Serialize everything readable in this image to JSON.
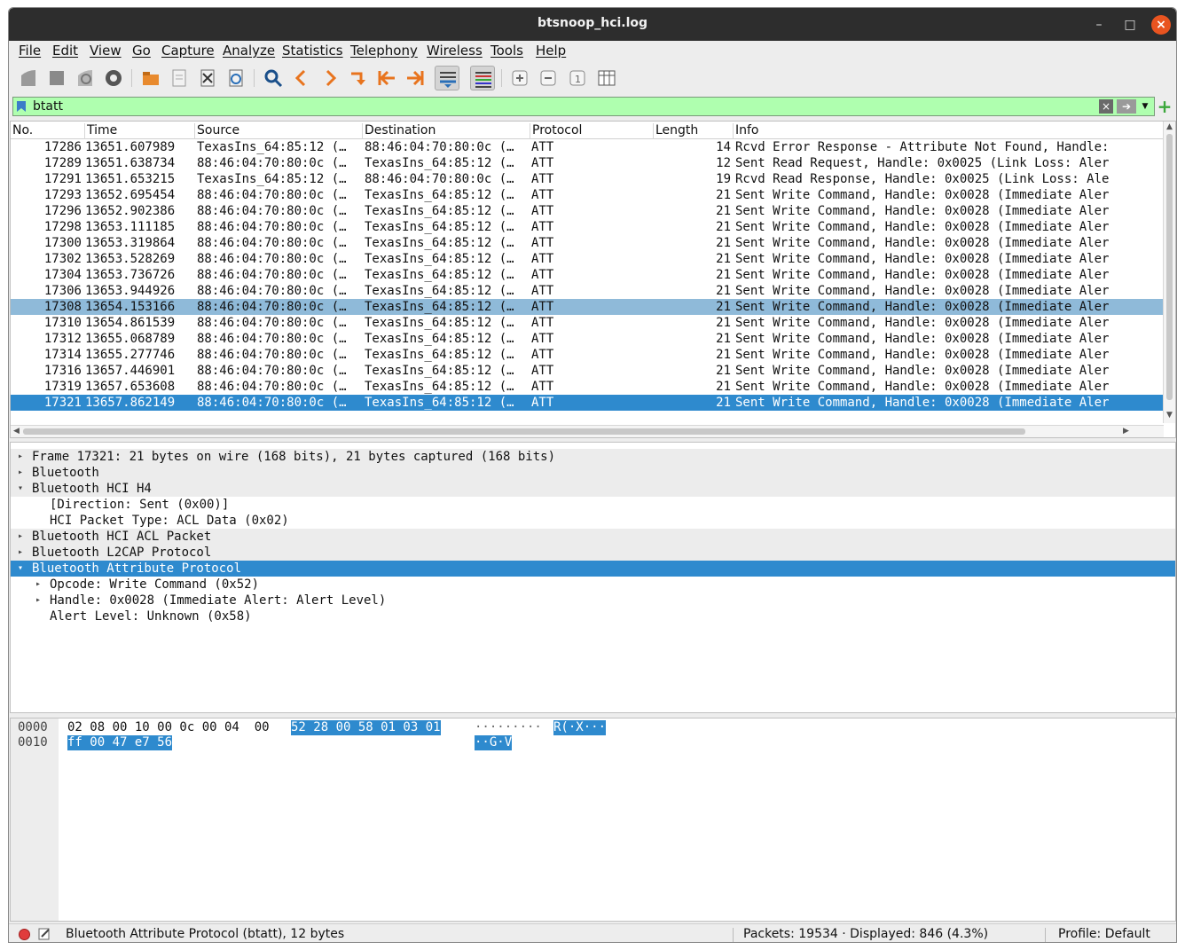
{
  "window": {
    "title": "btsnoop_hci.log"
  },
  "menu": [
    "File",
    "Edit",
    "View",
    "Go",
    "Capture",
    "Analyze",
    "Statistics",
    "Telephony",
    "Wireless",
    "Tools",
    "Help"
  ],
  "filter": {
    "value": "btatt"
  },
  "columns": [
    "No.",
    "Time",
    "Source",
    "Destination",
    "Protocol",
    "Length",
    "Info"
  ],
  "packets": [
    {
      "no": "17286",
      "time": "13651.607989",
      "src": "TexasIns_64:85:12 (…",
      "dst": "88:46:04:70:80:0c (…",
      "proto": "ATT",
      "len": "14",
      "info": "Rcvd Error Response - Attribute Not Found, Handle:",
      "state": ""
    },
    {
      "no": "17289",
      "time": "13651.638734",
      "src": "88:46:04:70:80:0c (…",
      "dst": "TexasIns_64:85:12 (…",
      "proto": "ATT",
      "len": "12",
      "info": "Sent Read Request, Handle: 0x0025 (Link Loss: Aler",
      "state": ""
    },
    {
      "no": "17291",
      "time": "13651.653215",
      "src": "TexasIns_64:85:12 (…",
      "dst": "88:46:04:70:80:0c (…",
      "proto": "ATT",
      "len": "19",
      "info": "Rcvd Read Response, Handle: 0x0025 (Link Loss: Ale",
      "state": ""
    },
    {
      "no": "17293",
      "time": "13652.695454",
      "src": "88:46:04:70:80:0c (…",
      "dst": "TexasIns_64:85:12 (…",
      "proto": "ATT",
      "len": "21",
      "info": "Sent Write Command, Handle: 0x0028 (Immediate Aler",
      "state": ""
    },
    {
      "no": "17296",
      "time": "13652.902386",
      "src": "88:46:04:70:80:0c (…",
      "dst": "TexasIns_64:85:12 (…",
      "proto": "ATT",
      "len": "21",
      "info": "Sent Write Command, Handle: 0x0028 (Immediate Aler",
      "state": ""
    },
    {
      "no": "17298",
      "time": "13653.111185",
      "src": "88:46:04:70:80:0c (…",
      "dst": "TexasIns_64:85:12 (…",
      "proto": "ATT",
      "len": "21",
      "info": "Sent Write Command, Handle: 0x0028 (Immediate Aler",
      "state": ""
    },
    {
      "no": "17300",
      "time": "13653.319864",
      "src": "88:46:04:70:80:0c (…",
      "dst": "TexasIns_64:85:12 (…",
      "proto": "ATT",
      "len": "21",
      "info": "Sent Write Command, Handle: 0x0028 (Immediate Aler",
      "state": ""
    },
    {
      "no": "17302",
      "time": "13653.528269",
      "src": "88:46:04:70:80:0c (…",
      "dst": "TexasIns_64:85:12 (…",
      "proto": "ATT",
      "len": "21",
      "info": "Sent Write Command, Handle: 0x0028 (Immediate Aler",
      "state": ""
    },
    {
      "no": "17304",
      "time": "13653.736726",
      "src": "88:46:04:70:80:0c (…",
      "dst": "TexasIns_64:85:12 (…",
      "proto": "ATT",
      "len": "21",
      "info": "Sent Write Command, Handle: 0x0028 (Immediate Aler",
      "state": ""
    },
    {
      "no": "17306",
      "time": "13653.944926",
      "src": "88:46:04:70:80:0c (…",
      "dst": "TexasIns_64:85:12 (…",
      "proto": "ATT",
      "len": "21",
      "info": "Sent Write Command, Handle: 0x0028 (Immediate Aler",
      "state": ""
    },
    {
      "no": "17308",
      "time": "13654.153166",
      "src": "88:46:04:70:80:0c (…",
      "dst": "TexasIns_64:85:12 (…",
      "proto": "ATT",
      "len": "21",
      "info": "Sent Write Command, Handle: 0x0028 (Immediate Aler",
      "state": "related"
    },
    {
      "no": "17310",
      "time": "13654.861539",
      "src": "88:46:04:70:80:0c (…",
      "dst": "TexasIns_64:85:12 (…",
      "proto": "ATT",
      "len": "21",
      "info": "Sent Write Command, Handle: 0x0028 (Immediate Aler",
      "state": ""
    },
    {
      "no": "17312",
      "time": "13655.068789",
      "src": "88:46:04:70:80:0c (…",
      "dst": "TexasIns_64:85:12 (…",
      "proto": "ATT",
      "len": "21",
      "info": "Sent Write Command, Handle: 0x0028 (Immediate Aler",
      "state": ""
    },
    {
      "no": "17314",
      "time": "13655.277746",
      "src": "88:46:04:70:80:0c (…",
      "dst": "TexasIns_64:85:12 (…",
      "proto": "ATT",
      "len": "21",
      "info": "Sent Write Command, Handle: 0x0028 (Immediate Aler",
      "state": ""
    },
    {
      "no": "17316",
      "time": "13657.446901",
      "src": "88:46:04:70:80:0c (…",
      "dst": "TexasIns_64:85:12 (…",
      "proto": "ATT",
      "len": "21",
      "info": "Sent Write Command, Handle: 0x0028 (Immediate Aler",
      "state": ""
    },
    {
      "no": "17319",
      "time": "13657.653608",
      "src": "88:46:04:70:80:0c (…",
      "dst": "TexasIns_64:85:12 (…",
      "proto": "ATT",
      "len": "21",
      "info": "Sent Write Command, Handle: 0x0028 (Immediate Aler",
      "state": ""
    },
    {
      "no": "17321",
      "time": "13657.862149",
      "src": "88:46:04:70:80:0c (…",
      "dst": "TexasIns_64:85:12 (…",
      "proto": "ATT",
      "len": "21",
      "info": "Sent Write Command, Handle: 0x0028 (Immediate Aler",
      "state": "selected"
    }
  ],
  "details": [
    {
      "text": "Frame 17321: 21 bytes on wire (168 bits), 21 bytes captured (168 bits)",
      "depth": 0,
      "tri": "right",
      "style": "hl"
    },
    {
      "text": "Bluetooth",
      "depth": 0,
      "tri": "right",
      "style": "hl"
    },
    {
      "text": "Bluetooth HCI H4",
      "depth": 0,
      "tri": "down",
      "style": "hl"
    },
    {
      "text": "[Direction: Sent (0x00)]",
      "depth": 1,
      "tri": "",
      "style": ""
    },
    {
      "text": "HCI Packet Type: ACL Data (0x02)",
      "depth": 1,
      "tri": "",
      "style": ""
    },
    {
      "text": "Bluetooth HCI ACL Packet",
      "depth": 0,
      "tri": "right",
      "style": "hl"
    },
    {
      "text": "Bluetooth L2CAP Protocol",
      "depth": 0,
      "tri": "right",
      "style": "hl"
    },
    {
      "text": "Bluetooth Attribute Protocol",
      "depth": 0,
      "tri": "down",
      "style": "sel"
    },
    {
      "text": "Opcode: Write Command (0x52)",
      "depth": 1,
      "tri": "right",
      "style": ""
    },
    {
      "text": "Handle: 0x0028 (Immediate Alert: Alert Level)",
      "depth": 1,
      "tri": "right",
      "style": ""
    },
    {
      "text": "Alert Level: Unknown (0x58)",
      "depth": 1,
      "tri": "",
      "style": ""
    }
  ],
  "hex": {
    "row0": {
      "offset": "0000",
      "bytes_plain": "02 08 00 10 00 0c 00 04  00",
      "bytes_hl": "52 28 00 58 01 03 01",
      "ascii_plain": "·········",
      "ascii_hl": "R(·X···"
    },
    "row1": {
      "offset": "0010",
      "bytes_plain": "",
      "bytes_hl": "ff 00 47 e7 56",
      "ascii_plain": "",
      "ascii_hl": "··G·V"
    }
  },
  "status": {
    "field": "Bluetooth Attribute Protocol (btatt), 12 bytes",
    "packets": "Packets: 19534 · Displayed: 846 (4.3%)",
    "profile": "Profile: Default"
  },
  "colors": {
    "selected": "#2e8ace",
    "related": "#8fbad9",
    "filter_ok": "#afffaf",
    "titlebar": "#2d2d2d"
  }
}
